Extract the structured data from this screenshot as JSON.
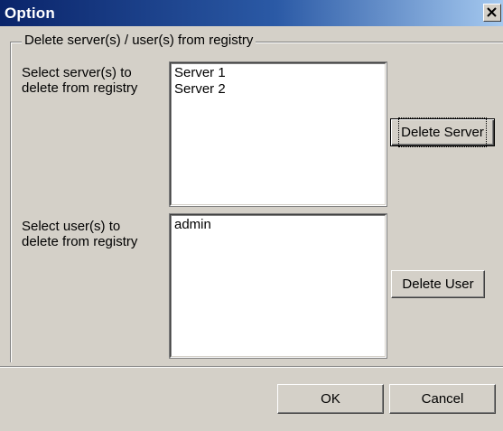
{
  "window": {
    "title": "Option"
  },
  "group": {
    "legend": "Delete server(s) / user(s) from registry"
  },
  "servers": {
    "label": "Select server(s) to\ndelete from registry",
    "items": [
      "Server 1",
      "Server 2"
    ],
    "delete_label": "Delete Server"
  },
  "users": {
    "label": "Select user(s) to\ndelete from registry",
    "items": [
      "admin"
    ],
    "delete_label": "Delete User"
  },
  "footer": {
    "ok_label": "OK",
    "cancel_label": "Cancel"
  },
  "colors": {
    "title_active_start": "#0a246a",
    "title_active_end": "#a6caf0",
    "face": "#d4d0c8"
  },
  "icons": {
    "close": "close-icon"
  }
}
